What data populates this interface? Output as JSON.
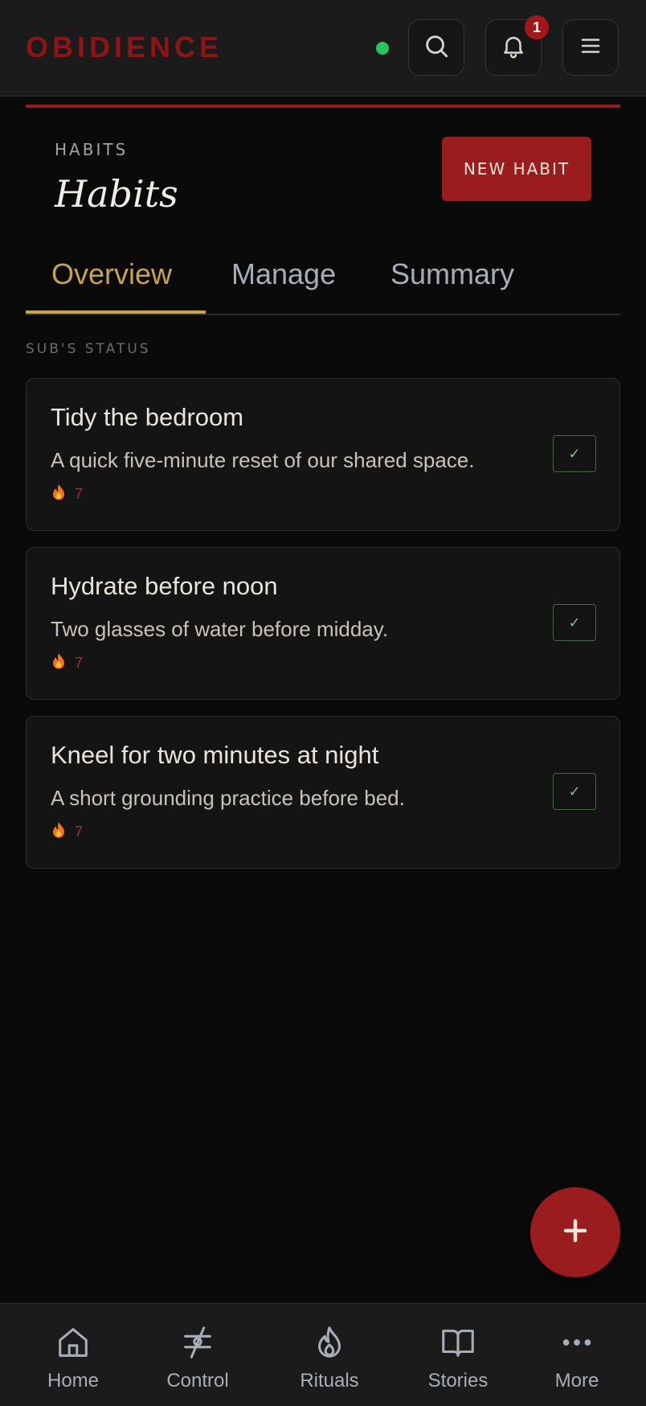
{
  "header": {
    "brand": "OBIDIENCE",
    "notification_count": "1",
    "icons": [
      "search-icon",
      "bell-icon",
      "menu-icon"
    ],
    "status_color": "#22c55e"
  },
  "page": {
    "eyebrow": "HABITS",
    "title": "Habits",
    "new_habit_label": "NEW HABIT"
  },
  "tabs": [
    {
      "label": "Overview",
      "active": true
    },
    {
      "label": "Manage",
      "active": false
    },
    {
      "label": "Summary",
      "active": false
    }
  ],
  "section": {
    "label": "SUB'S STATUS"
  },
  "habits": [
    {
      "title": "Tidy the bedroom",
      "description": "A quick five-minute reset of our shared space.",
      "streak": "7",
      "check": "✓"
    },
    {
      "title": "Hydrate before noon",
      "description": "Two glasses of water before midday.",
      "streak": "7",
      "check": "✓"
    },
    {
      "title": "Kneel for two minutes at night",
      "description": "A short grounding practice before bed.",
      "streak": "7",
      "check": "✓"
    }
  ],
  "fab": {
    "icon": "plus-icon"
  },
  "nav": [
    {
      "label": "Home",
      "icon": "home-icon"
    },
    {
      "label": "Control",
      "icon": "control-icon"
    },
    {
      "label": "Rituals",
      "icon": "flame-icon"
    },
    {
      "label": "Stories",
      "icon": "book-icon"
    },
    {
      "label": "More",
      "icon": "more-icon"
    }
  ],
  "colors": {
    "accent_red": "#9b1c1f",
    "tab_gold": "#c9a24e",
    "background": "#0a0a0a"
  }
}
